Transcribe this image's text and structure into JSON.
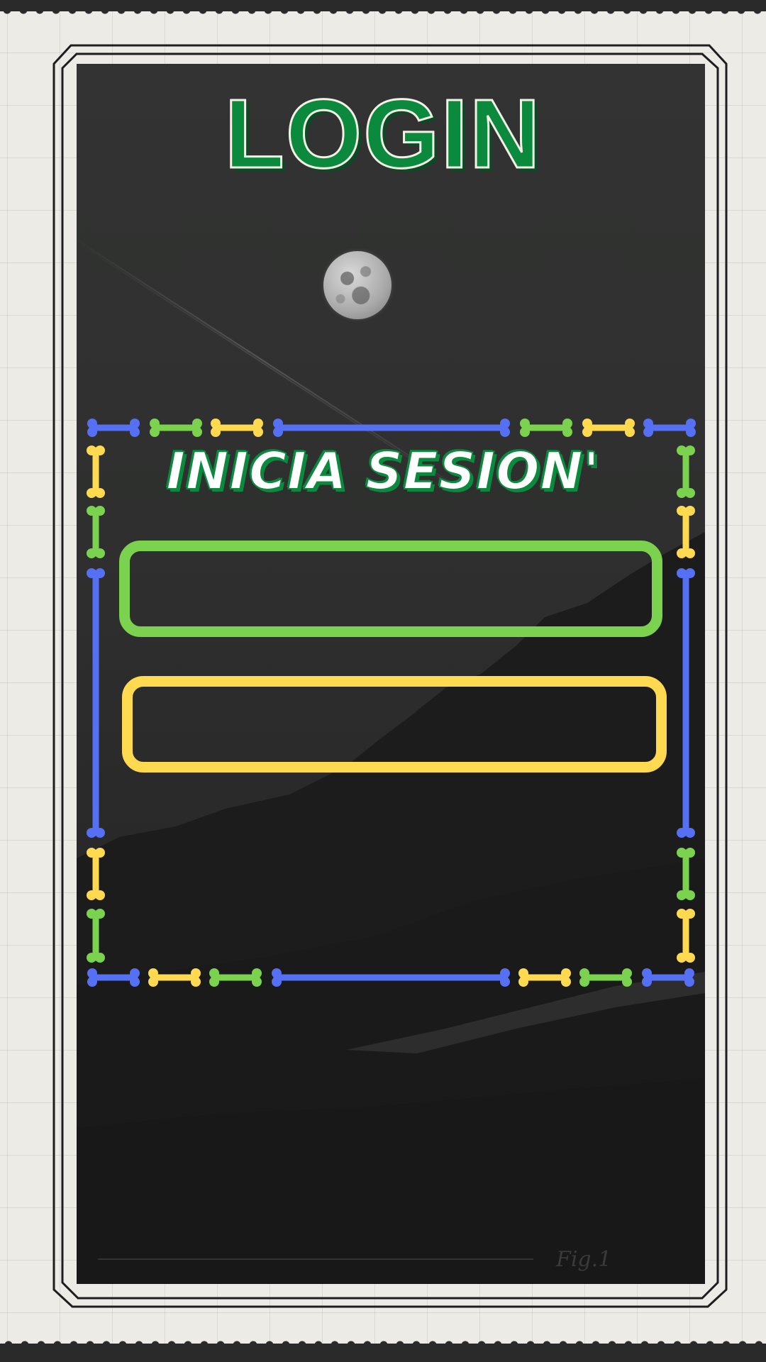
{
  "screen": {
    "title": "LOGIN",
    "subtitle": "INICIA SESION'",
    "figure_label": "Fig.1"
  },
  "form": {
    "username_field": {
      "value": "",
      "placeholder": ""
    },
    "password_field": {
      "value": "",
      "placeholder": ""
    }
  },
  "colors": {
    "title_green": "#0b8a3e",
    "bone_blue": "#5570f2",
    "bone_green": "#7bd24f",
    "bone_yellow": "#ffd94f",
    "paper": "#ecebe6",
    "photo_dark": "#2e2f2e"
  },
  "decorations": {
    "icons": [
      "moon-icon",
      "bone-icon"
    ]
  }
}
